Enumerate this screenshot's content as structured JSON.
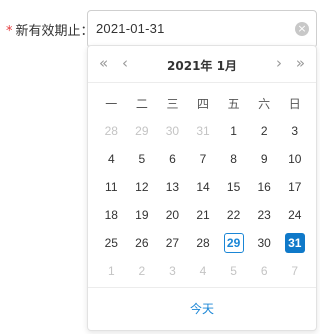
{
  "field": {
    "required_mark": "*",
    "label": "新有效期止：",
    "value": "2021-01-31",
    "clear_icon": "clear-circle-icon"
  },
  "calendar": {
    "title": "2021年 1月",
    "nav": {
      "prev_year": "«",
      "prev_month": "‹",
      "next_month": "›",
      "next_year": "»"
    },
    "weekdays": [
      "一",
      "二",
      "三",
      "四",
      "五",
      "六",
      "日"
    ],
    "weeks": [
      [
        {
          "d": "28",
          "m": true
        },
        {
          "d": "29",
          "m": true
        },
        {
          "d": "30",
          "m": true
        },
        {
          "d": "31",
          "m": true
        },
        {
          "d": "1"
        },
        {
          "d": "2"
        },
        {
          "d": "3"
        }
      ],
      [
        {
          "d": "4"
        },
        {
          "d": "5"
        },
        {
          "d": "6"
        },
        {
          "d": "7"
        },
        {
          "d": "8"
        },
        {
          "d": "9"
        },
        {
          "d": "10"
        }
      ],
      [
        {
          "d": "11"
        },
        {
          "d": "12"
        },
        {
          "d": "13"
        },
        {
          "d": "14"
        },
        {
          "d": "15"
        },
        {
          "d": "16"
        },
        {
          "d": "17"
        }
      ],
      [
        {
          "d": "18"
        },
        {
          "d": "19"
        },
        {
          "d": "20"
        },
        {
          "d": "21"
        },
        {
          "d": "22"
        },
        {
          "d": "23"
        },
        {
          "d": "24"
        }
      ],
      [
        {
          "d": "25"
        },
        {
          "d": "26"
        },
        {
          "d": "27"
        },
        {
          "d": "28"
        },
        {
          "d": "29",
          "today": true
        },
        {
          "d": "30"
        },
        {
          "d": "31",
          "selected": true
        }
      ],
      [
        {
          "d": "1",
          "m": true
        },
        {
          "d": "2",
          "m": true
        },
        {
          "d": "3",
          "m": true
        },
        {
          "d": "4",
          "m": true
        },
        {
          "d": "5",
          "m": true
        },
        {
          "d": "6",
          "m": true
        },
        {
          "d": "7",
          "m": true
        }
      ]
    ],
    "today_button": "今天"
  },
  "colors": {
    "accent": "#1a86d6",
    "selected_bg": "#0f79c9",
    "required": "#e4393c",
    "muted": "#c4c4c4"
  }
}
